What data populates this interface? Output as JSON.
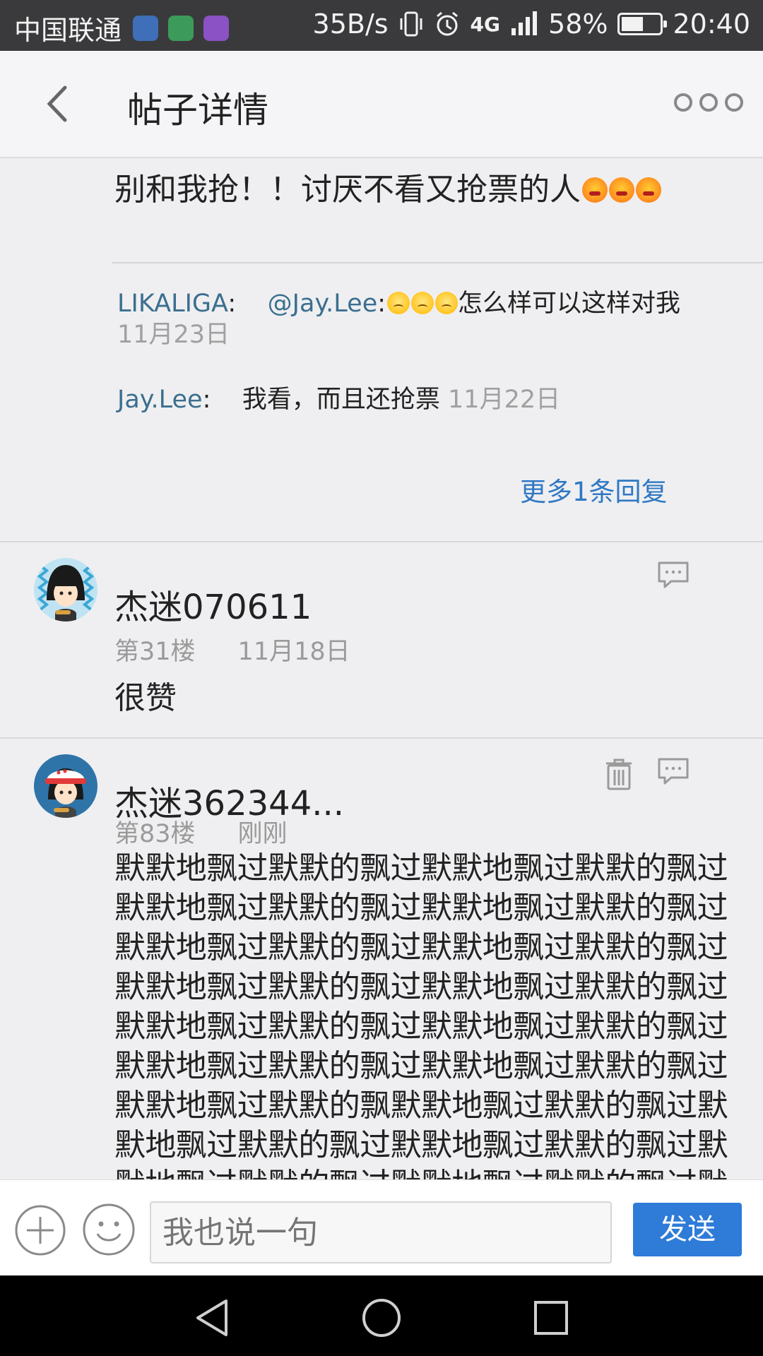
{
  "status_bar": {
    "carrier": "中国联通",
    "speed": "35B/s",
    "network": "4G",
    "battery": "58%",
    "battery_level": 0.58,
    "time": "20:40"
  },
  "header": {
    "title": "帖子详情"
  },
  "post_top": {
    "text": "别和我抢！！讨厌不看又抢票的人"
  },
  "replies": [
    {
      "name": "LIKALIGA",
      "mention": "@Jay.Lee",
      "text": "怎么样可以这样对我",
      "date": "11月23日"
    },
    {
      "name": "Jay.Lee",
      "text": "我看，而且还抢票",
      "date": "11月22日"
    }
  ],
  "more_replies": "更多1条回复",
  "posts": [
    {
      "username": "杰迷070611",
      "floor": "第31楼",
      "date": "11月18日",
      "content": "很赞"
    },
    {
      "username": "杰迷362344...",
      "floor": "第83楼",
      "date": "刚刚",
      "content": "默默地飘过默默的飘过默默地飘过默默的飘过默默地飘过默默的飘过默默地飘过默默的飘过默默地飘过默默的飘过默默地飘过默默的飘过默默地飘过默默的飘过默默地飘过默默的飘过默默地飘过默默的飘过默默地飘过默默的飘过默默地飘过默默的飘过默默地飘过默默的飘过默默地飘过默默的飘默默地飘过默默的飘过默默地飘过默默的飘过默默地飘过默默的飘过默默地飘过默默的飘过默默地飘过默默的飘过默默地飘过默默的飘过默默"
    }
  ],
  "input_bar": {
    "placeholder": "我也说一句",
    "send_label": "发送"
  },
  "colors": {
    "accent": "#2e7bd8",
    "name_link": "#3b6f8f",
    "more_link": "#2f78c4"
  }
}
